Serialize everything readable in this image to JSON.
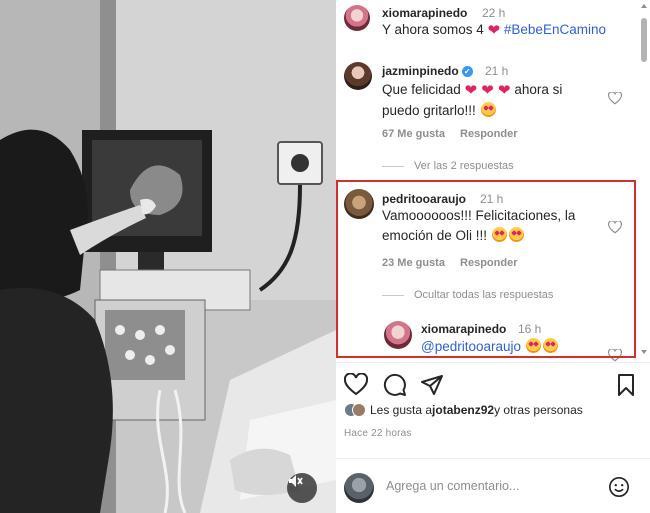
{
  "comments": [
    {
      "username": "xiomarapinedo",
      "time": "22 h",
      "text": "Y ahora somos 4 ",
      "heart": "❤",
      "hashtag": "#BebeEnCamino"
    },
    {
      "username": "jazminpinedo",
      "time": "21 h",
      "text_a": "Que felicidad ",
      "hearts": "❤ ❤ ❤",
      "text_b": " ahora si",
      "text_line2": "puedo gritarlo!!! ",
      "likes": "67 Me gusta",
      "reply": "Responder",
      "view_replies": "Ver las 2 respuestas"
    },
    {
      "username": "pedritooaraujo",
      "time": "21 h",
      "text_line1": "Vamoooooos!!! Felicitaciones, la",
      "text_line2": "emoción de Oli !!! ",
      "likes": "23 Me gusta",
      "reply": "Responder",
      "hide_replies": "Ocultar todas las respuestas"
    },
    {
      "username": "xiomarapinedo",
      "time": "16 h",
      "mention": "@pedritooaraujo"
    }
  ],
  "liked_by": {
    "prefix": "Les gusta a ",
    "user": "jotabenz92",
    "suffix": " y otras personas"
  },
  "post_date": "Hace 22 horas",
  "comment_box": {
    "placeholder": "Agrega un comentario..."
  },
  "colors": {
    "highlight": "#d0312d",
    "link": "#2f5fd6",
    "heart": "#e0245e"
  },
  "icons": [
    "heart-icon",
    "comment-icon",
    "share-icon",
    "bookmark-icon",
    "emoji-icon",
    "mute-icon"
  ]
}
